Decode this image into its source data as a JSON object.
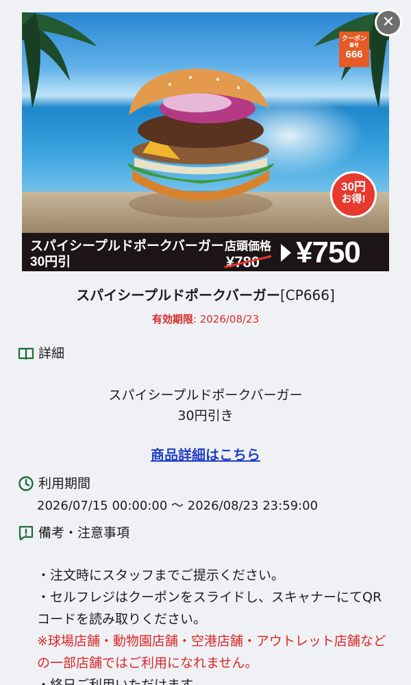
{
  "hero": {
    "coupon_badge": {
      "line1": "クーポン",
      "line2": "番号",
      "line3": "666"
    },
    "save_badge": {
      "amount": "30円",
      "suffix": "お得!"
    },
    "banner": {
      "product_name": "スパイシープルドポークバーガー",
      "discount_label": "30円引",
      "store_price_label": "店頭価格",
      "old_price": "¥780",
      "new_price": "¥750"
    }
  },
  "close_button": {
    "glyph": "✕"
  },
  "coupon": {
    "title": "スパイシープルドポークバーガー",
    "code": "[CP666]",
    "expiry_label": "有効期限",
    "expiry_sep": ":",
    "expiry_value": " 2026/08/23"
  },
  "details": {
    "heading": "詳細",
    "line1": "スパイシープルドポークバーガー",
    "line2": "30円引き",
    "link_label": "商品詳細はこちら"
  },
  "usage_period": {
    "heading": "利用期間",
    "value": "2026/07/15 00:00:00 〜 2026/08/23 23:59:00"
  },
  "remarks": {
    "heading": "備考・注意事項",
    "note1": "・注文時にスタッフまでご提示ください。",
    "note2": "・セルフレジはクーポンをスライドし、スキャナーにてQRコードを読み取りください。",
    "warning": "※球場店舗・動物園店舗・空港店舗・アウトレット店舗などの一部店舗ではご利用になれません。",
    "note3": "・終日ご利用いただけます。"
  },
  "colors": {
    "background": "#f0f1f5",
    "accent_red": "#d72828",
    "link_blue": "#1f3fc8",
    "icon_green": "#1e6b3a",
    "banner_dark": "#1d1515"
  },
  "icons": [
    "book-icon",
    "clock-icon",
    "alert-icon",
    "close-icon"
  ]
}
